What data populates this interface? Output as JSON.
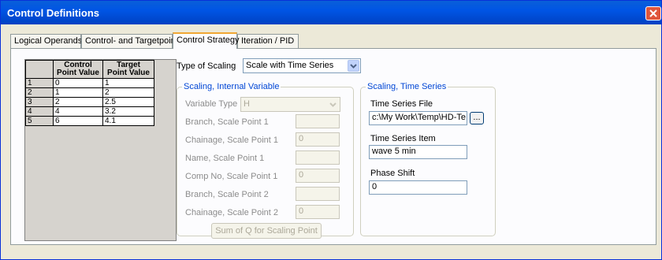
{
  "window": {
    "title": "Control Definitions"
  },
  "tabs": [
    {
      "label": "Logical Operands"
    },
    {
      "label": "Control- and Targetpoint"
    },
    {
      "label": "Control Strategy"
    },
    {
      "label": "Iteration / PID"
    }
  ],
  "grid": {
    "headers": [
      [
        "Control",
        "Point Value"
      ],
      [
        "Target",
        "Point Value"
      ]
    ],
    "rows": [
      {
        "n": "1",
        "control": "0",
        "target": "1"
      },
      {
        "n": "2",
        "control": "1",
        "target": "2"
      },
      {
        "n": "3",
        "control": "2",
        "target": "2.5"
      },
      {
        "n": "4",
        "control": "4",
        "target": "3.2"
      },
      {
        "n": "5",
        "control": "6",
        "target": "4.1"
      }
    ]
  },
  "type_of_scaling": {
    "label": "Type of Scaling",
    "value": "Scale with Time Series"
  },
  "internal": {
    "legend": "Scaling, Internal Variable",
    "variable_type_label": "Variable Type",
    "variable_type_value": "H",
    "branch1_label": "Branch, Scale Point 1",
    "branch1_value": "",
    "chainage1_label": "Chainage, Scale Point 1",
    "chainage1_value": "0",
    "name1_label": "Name, Scale Point 1",
    "name1_value": "",
    "comp1_label": "Comp No, Scale Point 1",
    "comp1_value": "0",
    "branch2_label": "Branch, Scale Point 2",
    "branch2_value": "",
    "chainage2_label": "Chainage, Scale Point 2",
    "chainage2_value": "0",
    "sum_button": "Sum of Q for Scaling Point"
  },
  "timeseries": {
    "legend": "Scaling, Time Series",
    "file_label": "Time Series File",
    "file_value": "c:\\My Work\\Temp\\HD-Te",
    "browse_label": "...",
    "item_label": "Time Series Item",
    "item_value": "wave 5 min",
    "phase_label": "Phase Shift",
    "phase_value": "0"
  },
  "colors": {
    "title_bar": "#0055e5",
    "close": "#e0563b",
    "group_legend": "#0046d5",
    "active_tab_accent": "#f1a734"
  }
}
